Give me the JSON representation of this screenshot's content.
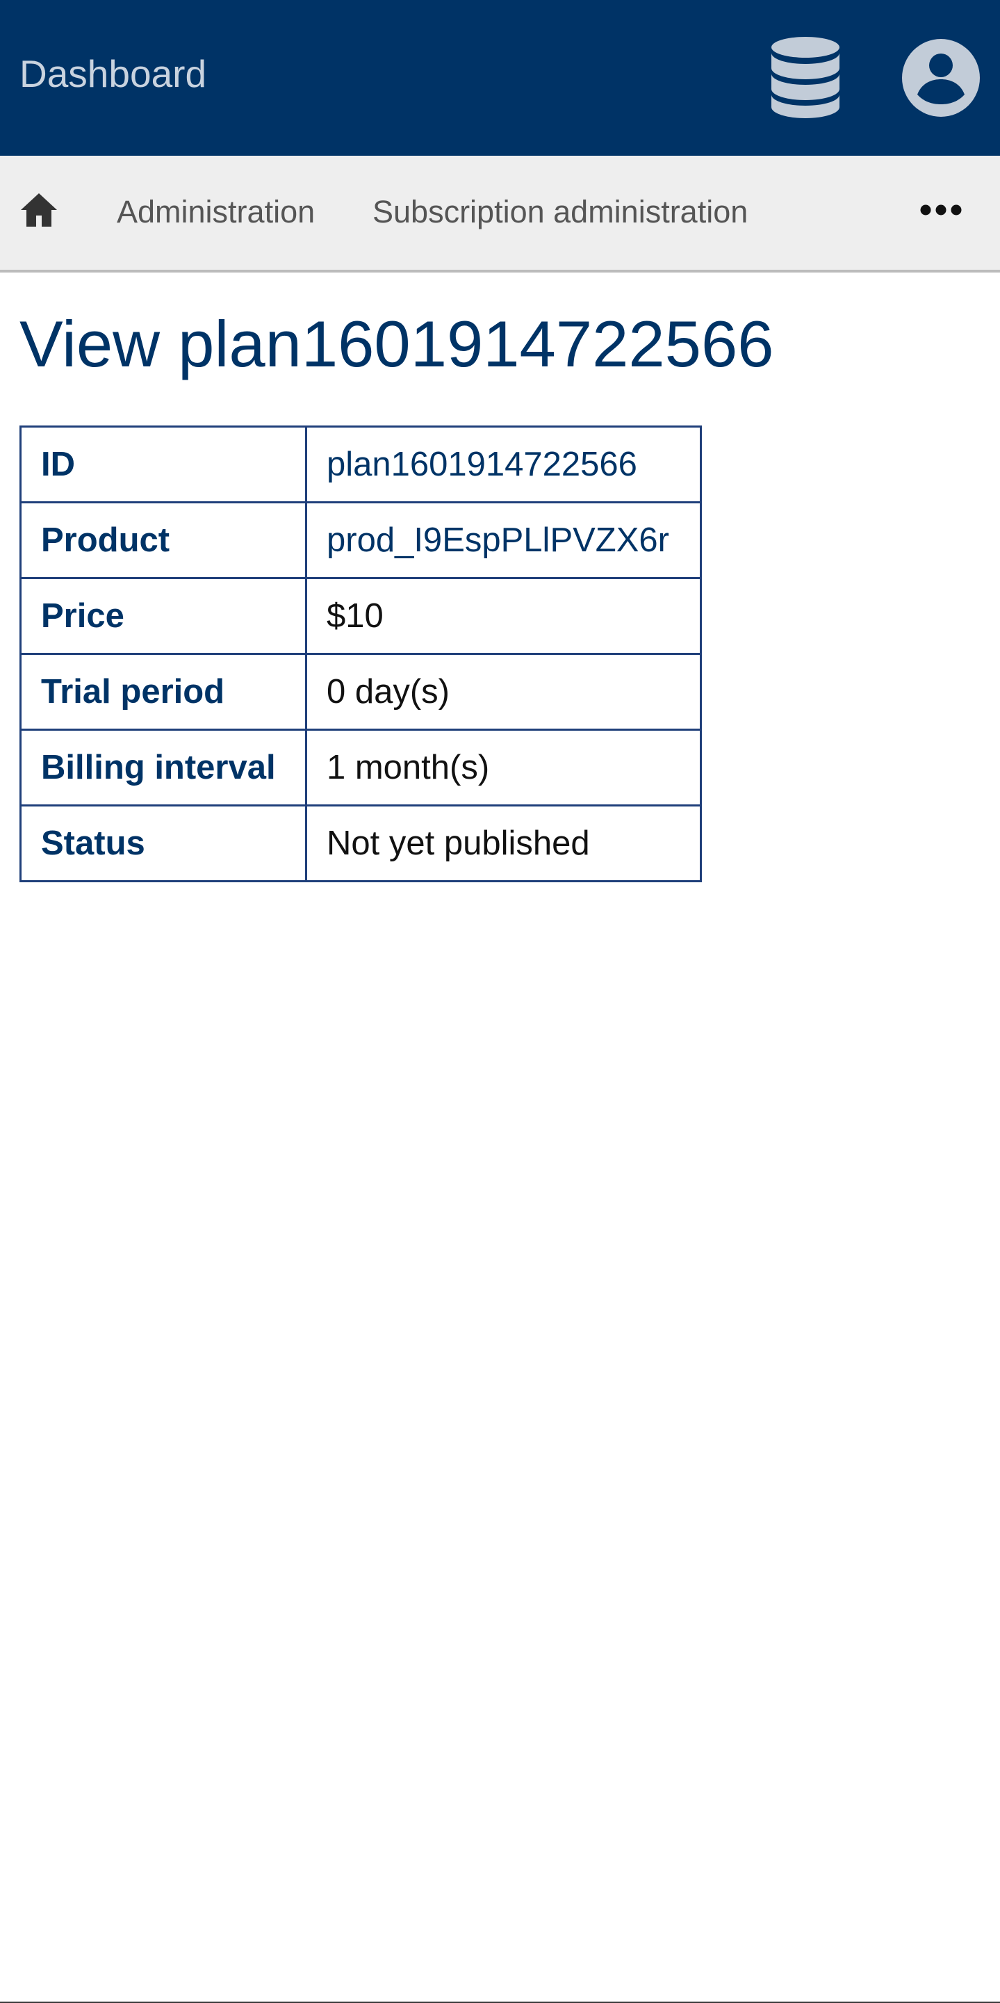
{
  "header": {
    "brand": "Dashboard",
    "icons": [
      "database-icon",
      "user-account-icon"
    ]
  },
  "nav": {
    "home_icon": "home-icon",
    "items": [
      "Administration",
      "Subscription administration"
    ],
    "more_icon": "more-options-icon"
  },
  "page": {
    "title": "View plan1601914722566"
  },
  "details": {
    "rows": [
      {
        "label": "ID",
        "value": "plan1601914722566"
      },
      {
        "label": "Product",
        "value": "prod_I9EspPLlPVZX6r"
      },
      {
        "label": "Price",
        "value": "$10"
      },
      {
        "label": "Trial period",
        "value": "0 day(s)"
      },
      {
        "label": "Billing interval",
        "value": "1 month(s)"
      },
      {
        "label": "Status",
        "value": "Not yet published"
      }
    ]
  },
  "colors": {
    "header_bg": "#003366",
    "nav_bg": "#eeeeee",
    "accent": "#003366",
    "table_border": "#1f3f7a"
  }
}
